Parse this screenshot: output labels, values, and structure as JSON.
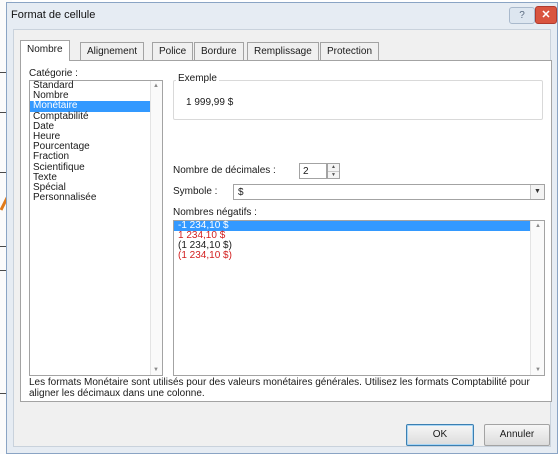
{
  "window": {
    "title": "Format de cellule",
    "help_label": "?",
    "close_label": "✕"
  },
  "tabs": [
    {
      "label": "Nombre",
      "active": true
    },
    {
      "label": "Alignement",
      "active": false
    },
    {
      "label": "Police",
      "active": false
    },
    {
      "label": "Bordure",
      "active": false
    },
    {
      "label": "Remplissage",
      "active": false
    },
    {
      "label": "Protection",
      "active": false
    }
  ],
  "category": {
    "label": "Catégorie :",
    "items": [
      "Standard",
      "Nombre",
      "Monétaire",
      "Comptabilité",
      "Date",
      "Heure",
      "Pourcentage",
      "Fraction",
      "Scientifique",
      "Texte",
      "Spécial",
      "Personnalisée"
    ],
    "selected_index": 2
  },
  "example": {
    "label": "Exemple",
    "value": "1 999,99 $"
  },
  "decimals": {
    "label": "Nombre de décimales :",
    "value": "2"
  },
  "symbol": {
    "label": "Symbole :",
    "value": "$"
  },
  "negatives": {
    "label": "Nombres négatifs :",
    "items": [
      {
        "text": "-1 234,10 $",
        "color": "#1a1a1a"
      },
      {
        "text": "1 234,10 $",
        "color": "#d21e1e"
      },
      {
        "text": "(1 234,10 $)",
        "color": "#1a1a1a"
      },
      {
        "text": "(1 234,10 $)",
        "color": "#d21e1e"
      }
    ],
    "selected_index": 0
  },
  "description": "Les formats Monétaire sont utilisés pour des valeurs monétaires générales. Utilisez les formats Comptabilité pour aligner les décimaux dans une colonne.",
  "buttons": {
    "ok": "OK",
    "cancel": "Annuler"
  },
  "colors": {
    "selection": "#3399ff",
    "negative_red": "#d21e1e",
    "arrow": "#e07a1a"
  }
}
